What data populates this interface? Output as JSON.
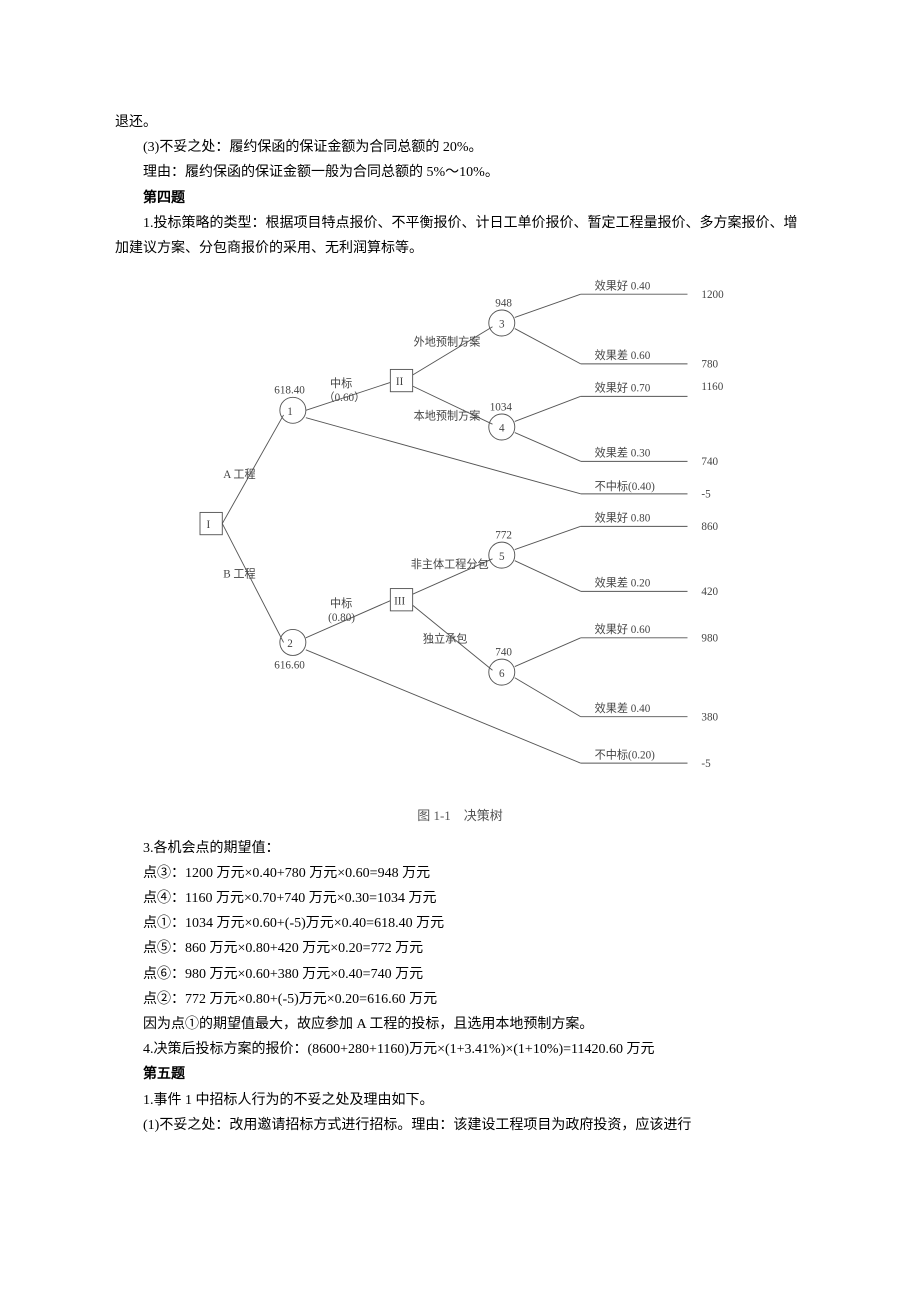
{
  "top": {
    "line1": "退还。",
    "line2": "(3)不妥之处：履约保函的保证金额为合同总额的 20%。",
    "line3": "理由：履约保函的保证金额一般为合同总额的 5%～10%。"
  },
  "q4": {
    "title": "第四题",
    "line1": "1.投标策略的类型：根据项目特点报价、不平衡报价、计日工单价报价、暂定工程量报价、多方案报价、增加建议方案、分包商报价的采用、无利润算标等。"
  },
  "diagram": {
    "caption": "图 1-1　决策树",
    "root": "I",
    "labelA": "A 工程",
    "labelB": "B 工程",
    "node1": {
      "id": "1",
      "val": "618.40"
    },
    "node2": {
      "id": "2",
      "val": "616.60"
    },
    "midA": {
      "line1": "中标",
      "line2": "（0.60）"
    },
    "midB": {
      "line1": "中标",
      "line2": "(0.80)"
    },
    "boxII": "II",
    "boxIII": "III",
    "labWaidi": "外地预制方案",
    "labBendi": "本地预制方案",
    "labFenbao": "非主体工程分包",
    "labDuli": "独立承包",
    "node3": {
      "id": "3",
      "val": "948"
    },
    "node4": {
      "id": "4",
      "val": "1034"
    },
    "node5": {
      "id": "5",
      "val": "772"
    },
    "node6": {
      "id": "6",
      "val": "740"
    },
    "buzhongA": "不中标(0.40)",
    "buzhongB": "不中标(0.20)",
    "leaves": {
      "l3a": {
        "label": "效果好 0.40",
        "val": "1200"
      },
      "l3b": {
        "label": "效果差 0.60",
        "val": "780"
      },
      "l4a": {
        "label": "效果好 0.70",
        "val": "1160"
      },
      "l4b": {
        "label": "效果差 0.30",
        "val": "740"
      },
      "l5a": {
        "label": "效果好 0.80",
        "val": "860"
      },
      "l5b": {
        "label": "效果差 0.20",
        "val": "420"
      },
      "l6a": {
        "label": "效果好 0.60",
        "val": "980"
      },
      "l6b": {
        "label": "效果差 0.40",
        "val": "380"
      },
      "nsA": "-5",
      "nsB": "-5"
    }
  },
  "calc": {
    "head": "3.各机会点的期望值：",
    "p3": "点③：1200 万元×0.40+780 万元×0.60=948 万元",
    "p4": "点④：1160 万元×0.70+740 万元×0.30=1034 万元",
    "p1": "点①：1034 万元×0.60+(-5)万元×0.40=618.40 万元",
    "p5": "点⑤：860 万元×0.80+420 万元×0.20=772 万元",
    "p6": "点⑥：980 万元×0.60+380 万元×0.40=740 万元",
    "p2": "点②：772 万元×0.80+(-5)万元×0.20=616.60 万元",
    "conc": "因为点①的期望值最大，故应参加 A 工程的投标，且选用本地预制方案。",
    "q4_4": "4.决策后投标方案的报价：(8600+280+1160)万元×(1+3.41%)×(1+10%)=11420.60 万元"
  },
  "q5": {
    "title": "第五题",
    "line1": "1.事件 1 中招标人行为的不妥之处及理由如下。",
    "line2": "(1)不妥之处：改用邀请招标方式进行招标。理由：该建设工程项目为政府投资，应该进行"
  },
  "chart_data": {
    "type": "decision-tree",
    "title": "图 1-1 决策树",
    "root": {
      "id": "I",
      "type": "decision"
    },
    "branches": [
      {
        "label": "A 工程",
        "chance_node": {
          "id": 1,
          "ev": 618.4
        },
        "outcomes": [
          {
            "label": "中标",
            "prob": 0.6,
            "decision_node": "II",
            "options": [
              {
                "label": "外地预制方案",
                "chance_node": {
                  "id": 3,
                  "ev": 948
                },
                "results": [
                  {
                    "label": "效果好",
                    "prob": 0.4,
                    "value": 1200
                  },
                  {
                    "label": "效果差",
                    "prob": 0.6,
                    "value": 780
                  }
                ]
              },
              {
                "label": "本地预制方案",
                "chance_node": {
                  "id": 4,
                  "ev": 1034
                },
                "results": [
                  {
                    "label": "效果好",
                    "prob": 0.7,
                    "value": 1160
                  },
                  {
                    "label": "效果差",
                    "prob": 0.3,
                    "value": 740
                  }
                ]
              }
            ]
          },
          {
            "label": "不中标",
            "prob": 0.4,
            "value": -5
          }
        ]
      },
      {
        "label": "B 工程",
        "chance_node": {
          "id": 2,
          "ev": 616.6
        },
        "outcomes": [
          {
            "label": "中标",
            "prob": 0.8,
            "decision_node": "III",
            "options": [
              {
                "label": "非主体工程分包",
                "chance_node": {
                  "id": 5,
                  "ev": 772
                },
                "results": [
                  {
                    "label": "效果好",
                    "prob": 0.8,
                    "value": 860
                  },
                  {
                    "label": "效果差",
                    "prob": 0.2,
                    "value": 420
                  }
                ]
              },
              {
                "label": "独立承包",
                "chance_node": {
                  "id": 6,
                  "ev": 740
                },
                "results": [
                  {
                    "label": "效果好",
                    "prob": 0.6,
                    "value": 980
                  },
                  {
                    "label": "效果差",
                    "prob": 0.4,
                    "value": 380
                  }
                ]
              }
            ]
          },
          {
            "label": "不中标",
            "prob": 0.2,
            "value": -5
          }
        ]
      }
    ]
  }
}
